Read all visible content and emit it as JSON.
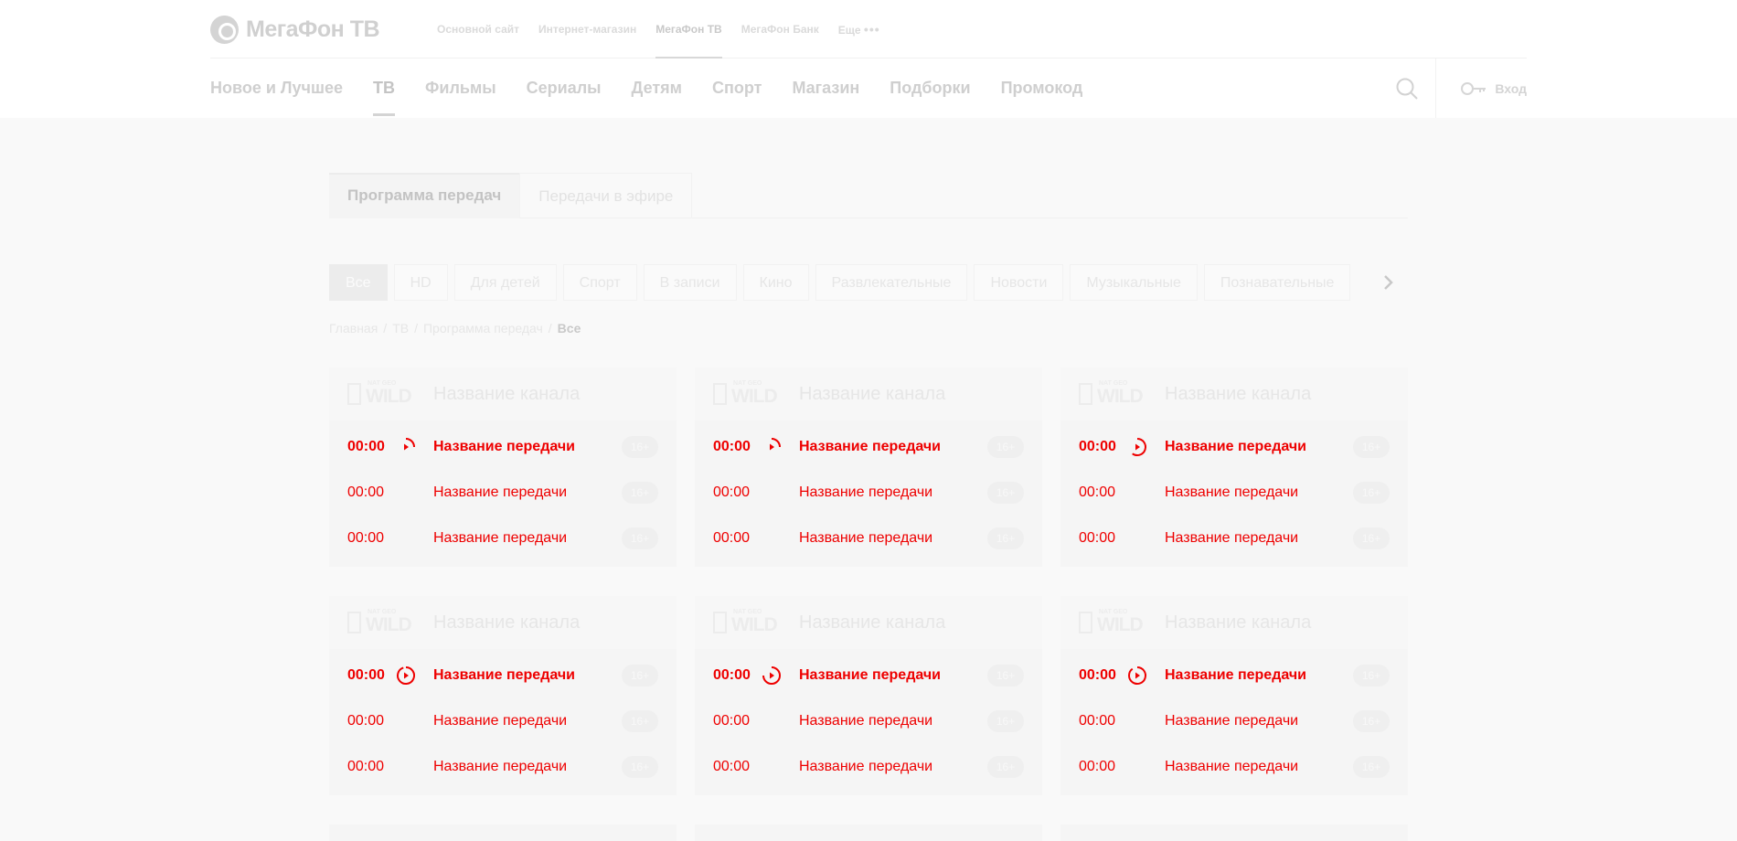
{
  "header": {
    "logo_text": "МегаФон ТВ",
    "top_links": [
      {
        "label": "Основной сайт",
        "active": false
      },
      {
        "label": "Интернет-магазин",
        "active": false
      },
      {
        "label": "МегаФон ТВ",
        "active": true
      },
      {
        "label": "МегаФон Банк",
        "active": false
      }
    ],
    "more_label": "Еще",
    "more_dots": "•••",
    "nav": [
      {
        "label": "Новое и Лучшее",
        "active": false
      },
      {
        "label": "ТВ",
        "active": true
      },
      {
        "label": "Фильмы",
        "active": false
      },
      {
        "label": "Сериалы",
        "active": false
      },
      {
        "label": "Детям",
        "active": false
      },
      {
        "label": "Спорт",
        "active": false
      },
      {
        "label": "Магазин",
        "active": false
      },
      {
        "label": "Подборки",
        "active": false
      },
      {
        "label": "Промокод",
        "active": false
      }
    ],
    "login_label": "Вход"
  },
  "tabs": [
    {
      "label": "Программа передач",
      "active": true
    },
    {
      "label": "Передачи в эфире",
      "active": false
    }
  ],
  "filters": [
    {
      "label": "Все",
      "active": true
    },
    {
      "label": "HD",
      "active": false
    },
    {
      "label": "Для детей",
      "active": false
    },
    {
      "label": "Спорт",
      "active": false
    },
    {
      "label": "В записи",
      "active": false
    },
    {
      "label": "Кино",
      "active": false
    },
    {
      "label": "Развлекательные",
      "active": false
    },
    {
      "label": "Новости",
      "active": false
    },
    {
      "label": "Музыкальные",
      "active": false
    },
    {
      "label": "Познавательные",
      "active": false
    }
  ],
  "breadcrumb": {
    "items": [
      "Главная",
      "ТВ",
      "Программа передач"
    ],
    "separator": "/",
    "current": "Все"
  },
  "channel_logo": {
    "brand": "WILD",
    "small_text": "NAT GEO"
  },
  "cards": [
    {
      "channel": "Название канала",
      "rows": [
        {
          "time": "00:00",
          "title": "Название передачи",
          "age": "16+",
          "current": true,
          "progress": 0.25
        },
        {
          "time": "00:00",
          "title": "Название передачи",
          "age": "16+",
          "current": false
        },
        {
          "time": "00:00",
          "title": "Название передачи",
          "age": "16+",
          "current": false
        }
      ]
    },
    {
      "channel": "Название канала",
      "rows": [
        {
          "time": "00:00",
          "title": "Название передачи",
          "age": "16+",
          "current": true,
          "progress": 0.25
        },
        {
          "time": "00:00",
          "title": "Название передачи",
          "age": "16+",
          "current": false
        },
        {
          "time": "00:00",
          "title": "Название передачи",
          "age": "16+",
          "current": false
        }
      ]
    },
    {
      "channel": "Название канала",
      "rows": [
        {
          "time": "00:00",
          "title": "Название передачи",
          "age": "16+",
          "current": true,
          "progress": 0.6
        },
        {
          "time": "00:00",
          "title": "Название передачи",
          "age": "16+",
          "current": false
        },
        {
          "time": "00:00",
          "title": "Название передачи",
          "age": "16+",
          "current": false
        }
      ]
    },
    {
      "channel": "Название канала",
      "rows": [
        {
          "time": "00:00",
          "title": "Название передачи",
          "age": "16+",
          "current": true,
          "progress": 0.95
        },
        {
          "time": "00:00",
          "title": "Название передачи",
          "age": "16+",
          "current": false
        },
        {
          "time": "00:00",
          "title": "Название передачи",
          "age": "16+",
          "current": false
        }
      ]
    },
    {
      "channel": "Название канала",
      "rows": [
        {
          "time": "00:00",
          "title": "Название передачи",
          "age": "16+",
          "current": true,
          "progress": 0.75
        },
        {
          "time": "00:00",
          "title": "Название передачи",
          "age": "16+",
          "current": false
        },
        {
          "time": "00:00",
          "title": "Название передачи",
          "age": "16+",
          "current": false
        }
      ]
    },
    {
      "channel": "Название канала",
      "rows": [
        {
          "time": "00:00",
          "title": "Название передачи",
          "age": "16+",
          "current": true,
          "progress": 0.9
        },
        {
          "time": "00:00",
          "title": "Название передачи",
          "age": "16+",
          "current": false
        },
        {
          "time": "00:00",
          "title": "Название передачи",
          "age": "16+",
          "current": false
        }
      ]
    }
  ],
  "colors": {
    "accent": "#ee0000"
  }
}
